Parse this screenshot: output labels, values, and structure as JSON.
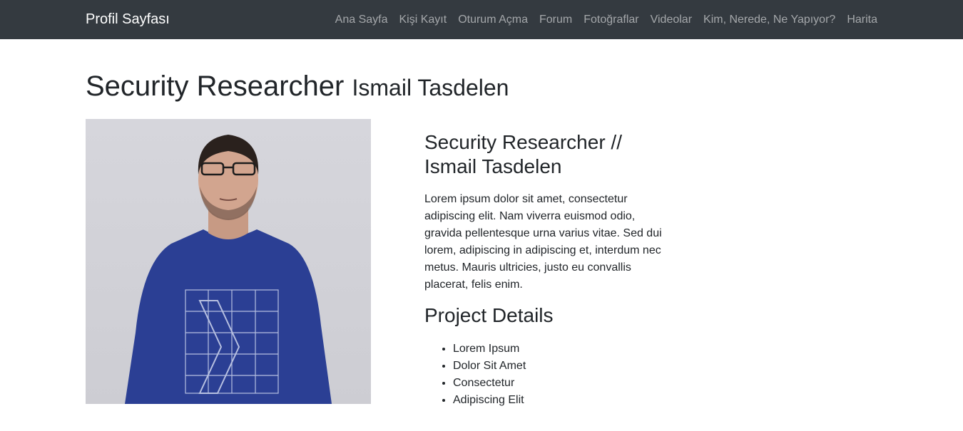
{
  "navbar": {
    "brand": "Profil Sayfası",
    "links": [
      "Ana Sayfa",
      "Kişi Kayıt",
      "Oturum Açma",
      "Forum",
      "Fotoğraflar",
      "Videolar",
      "Kim, Nerede, Ne Yapıyor?",
      "Harita"
    ]
  },
  "page": {
    "title": "Security Researcher",
    "subtitle": "Ismail Tasdelen"
  },
  "profile": {
    "heading": "Security Researcher // Ismail Tasdelen",
    "description": "Lorem ipsum dolor sit amet, consectetur adipiscing elit. Nam viverra euismod odio, gravida pellentesque urna varius vitae. Sed dui lorem, adipiscing in adipiscing et, interdum nec metus. Mauris ultricies, justo eu convallis placerat, felis enim.",
    "project_heading": "Project Details",
    "project_items": [
      "Lorem Ipsum",
      "Dolor Sit Amet",
      "Consectetur",
      "Adipiscing Elit"
    ]
  },
  "colors": {
    "navbar_bg": "#343a40",
    "shirt": "#2b3f94"
  }
}
